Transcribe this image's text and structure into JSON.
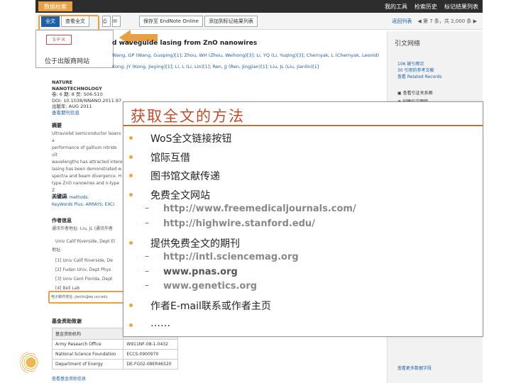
{
  "topbar": {
    "tab_label": "数据检索",
    "links": [
      "我的工具",
      "检索历史",
      "标记结果列表"
    ]
  },
  "subbar": {
    "btn_fulltext": "全文",
    "btn_publisher": "查看全文",
    "endnote_label": "保存至 EndNote Online",
    "add_marked": "添加到标记结果列表",
    "back_link": "返回列表",
    "pager_text": "◀ 第 7 条，共 2,000 条 ▶"
  },
  "dropdown": {
    "sfx_label": "S·F·X",
    "ill_label": "位于出版商网站"
  },
  "article": {
    "title": "d waveguide lasing from ZnO nanowires",
    "authors_line1": "Wang, GP (Wang, Guoping)[1]; Zhou, WH (Zhou, Weihong)[3]; Li, YQ (Li, Yuqing)[3]; Chernyak, L (Chernyak, Leonid)",
    "authors_line2": "Kong, JY (Kong, Jieying)[1]; Li, L (Li, Lin)[1]; Ren, JJ (Ren, Jingjian)[1]; Liu, JL (Liu, Jianlin)[1]"
  },
  "meta": {
    "journal": "NATURE NANOTECHNOLOGY",
    "volume": "卷: 6  期: 8  页: 506-510",
    "doi": "DOI: 10.1038/NNANO.2011.97",
    "published": "出版年: AUG 2011",
    "journal_info_link": "查看期刊信息"
  },
  "sections": {
    "abstract": "摘要",
    "abstract_lines": [
      "Ultraviolet semiconductor lasers a",
      "performance of gallium nitride ult",
      "wavelengths has attracted intere",
      "lasing has been demonstrated w",
      "spectra and beam divergence. H",
      "type ZnO nanowires and n-type Z",
      "domain methods."
    ],
    "keywords": "关键词",
    "keywords_plus": "KeyWords Plus: ARRAYS; EXCI",
    "author_info": "作者信息",
    "reprint": "通讯作者地址: Liu, JL (通讯作者",
    "address_label": "地址:",
    "addresses": [
      "Univ Calif Riverside, Dept El",
      "[1] Univ Calif Riverside, De",
      "[2] Fudan Univ, Dept Phys",
      "[3] Univ Cent Florida, Dept",
      "[4] Bell Lab"
    ],
    "email": "电子邮件地址: jianlin@ee.ucr.edu",
    "funding": "基金资助致谢",
    "funding_headers": [
      "基金资助机构",
      "授权号"
    ],
    "funding_rows": [
      [
        "Army Research Office",
        "W911NF-08-1-0432"
      ],
      [
        "National Science Foundation",
        "ECCS-0900970"
      ],
      [
        "Department of Energy",
        "DE-FG02-08ER46520"
      ]
    ],
    "funding_more": "查看基金资助信息"
  },
  "right_panel": {
    "title": "引文网络",
    "links": [
      "106 被引频次",
      "30 引用的参考文献",
      "查看 Related Records"
    ],
    "icons": [
      "查看引证关系图",
      "创建引文跟踪"
    ],
    "foot": "查看更多数据字段"
  },
  "overlay": {
    "title": "获取全文的方法",
    "items": [
      {
        "text": "WoS全文链接按钮"
      },
      {
        "text": "馆际互借"
      },
      {
        "text": "图书馆文献传递"
      },
      {
        "text": "免费全文网站"
      },
      {
        "text": "http://www.freemedicaljournals.com/",
        "sub": true
      },
      {
        "text": "http://highwire.stanford.edu/",
        "sub": true
      },
      {
        "text": "提供免费全文的期刊"
      },
      {
        "text": "http://intl.sciencemag.org",
        "sub": true
      },
      {
        "text": "www.pnas.org",
        "sub": true
      },
      {
        "text": "www.genetics.org",
        "sub": true
      },
      {
        "text": "作者E-mail联系或作者主页"
      },
      {
        "text": "……"
      }
    ]
  },
  "colors": {
    "accent": "#e8a045",
    "title_red": "#c44a2a",
    "bullet": "#f0a830",
    "link_blue": "#1e5fa8"
  }
}
